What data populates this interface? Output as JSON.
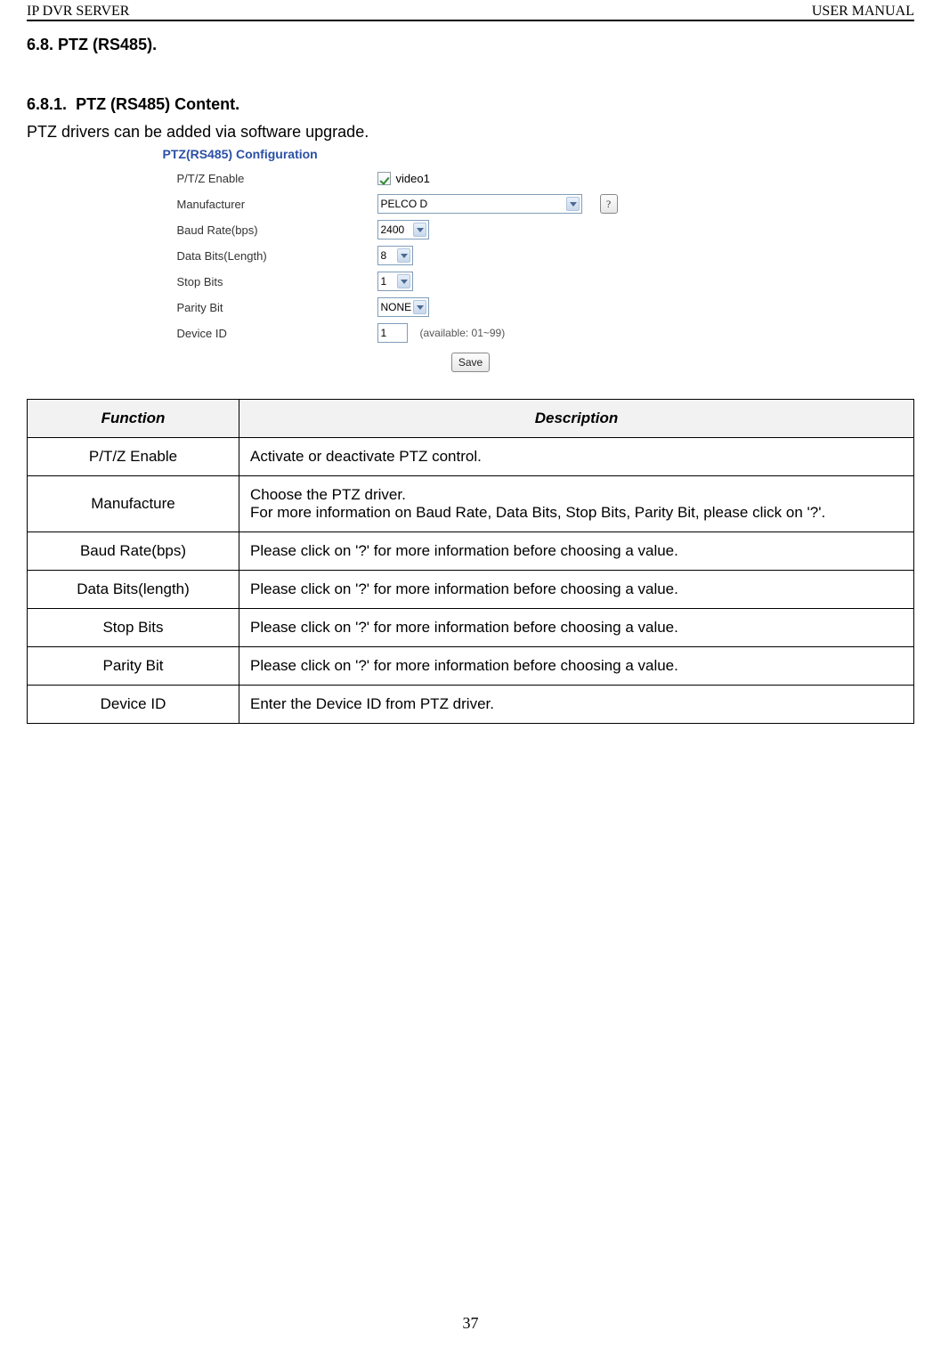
{
  "header": {
    "left": "IP DVR SERVER",
    "right": "USER MANUAL"
  },
  "section": {
    "num": "6.8.",
    "title": "PTZ (RS485)."
  },
  "subsection": {
    "num": "6.8.1.",
    "title": "PTZ (RS485) Content."
  },
  "intro": "PTZ drivers can be added via software upgrade.",
  "config": {
    "title": "PTZ(RS485) Configuration",
    "rows": {
      "enable": {
        "label": "P/T/Z Enable",
        "value": "video1"
      },
      "mfr": {
        "label": "Manufacturer",
        "value": "PELCO D",
        "help": "?"
      },
      "baud": {
        "label": "Baud Rate(bps)",
        "value": "2400"
      },
      "databits": {
        "label": "Data Bits(Length)",
        "value": "8"
      },
      "stopbits": {
        "label": "Stop Bits",
        "value": "1"
      },
      "parity": {
        "label": "Parity Bit",
        "value": "NONE"
      },
      "deviceid": {
        "label": "Device ID",
        "value": "1",
        "hint": "(available: 01~99)"
      }
    },
    "save": "Save"
  },
  "table": {
    "headers": {
      "fn": "Function",
      "ds": "Description"
    },
    "rows": [
      {
        "fn": "P/T/Z Enable",
        "ds": "Activate or deactivate PTZ control."
      },
      {
        "fn": "Manufacture",
        "ds": "Choose the PTZ driver.\nFor more information on Baud Rate, Data Bits, Stop Bits, Parity Bit, please click on '?'."
      },
      {
        "fn": "Baud Rate(bps)",
        "ds": "Please click on '?' for more information before choosing a value."
      },
      {
        "fn": "Data Bits(length)",
        "ds": "Please click on '?' for more information before choosing a value."
      },
      {
        "fn": "Stop Bits",
        "ds": "Please click on '?' for more information before choosing a value."
      },
      {
        "fn": "Parity Bit",
        "ds": "Please click on '?' for more information before choosing a value."
      },
      {
        "fn": "Device ID",
        "ds": "Enter the Device ID from PTZ driver."
      }
    ]
  },
  "page_number": "37"
}
